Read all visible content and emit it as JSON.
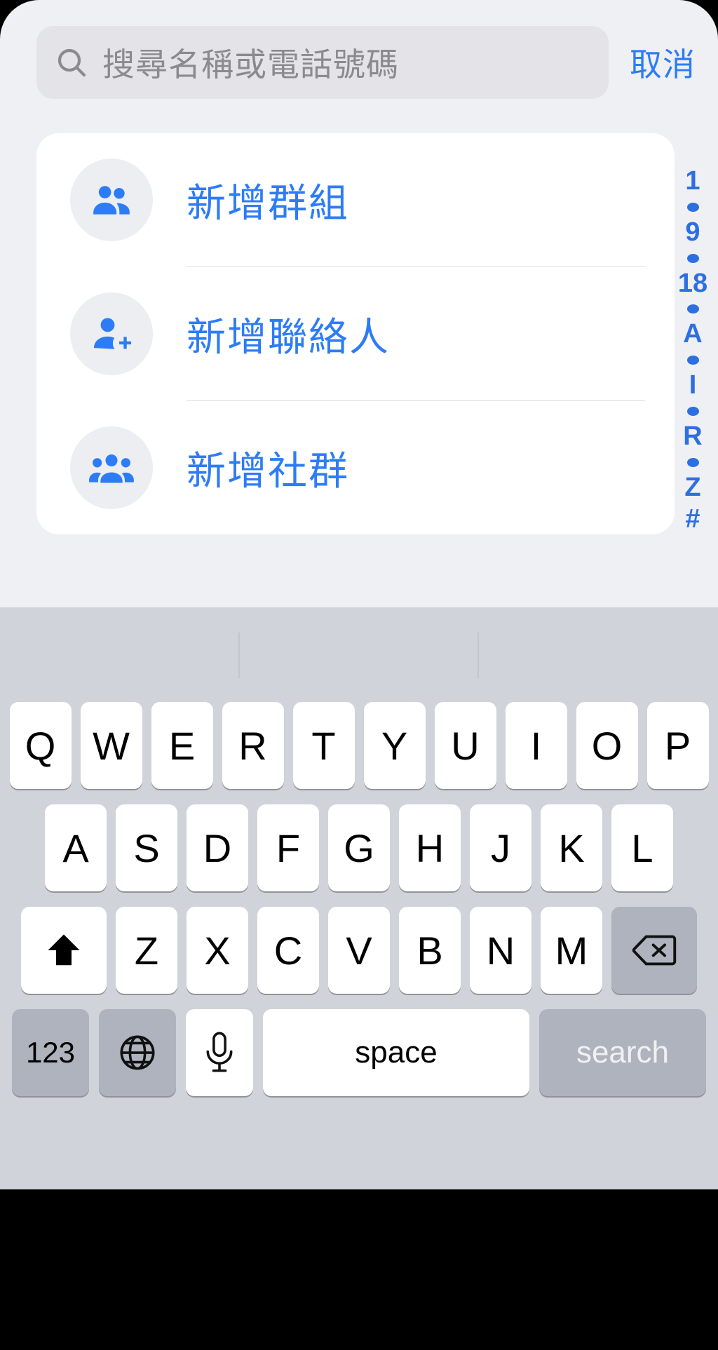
{
  "app": {
    "background_color": "#eff0f4",
    "accent_color": "#2d7cf6"
  },
  "search": {
    "placeholder": "搜尋名稱或電話號碼",
    "value": "",
    "icon": "search-icon",
    "cancel_label": "取消"
  },
  "actions": [
    {
      "label": "新增群組",
      "icon": "group-two-people-icon"
    },
    {
      "label": "新增聯絡人",
      "icon": "person-add-icon"
    },
    {
      "label": "新增社群",
      "icon": "community-three-people-icon"
    }
  ],
  "index_strip": {
    "entries": [
      "1",
      "•",
      "9",
      "•",
      "18",
      "•",
      "A",
      "•",
      "I",
      "•",
      "R",
      "•",
      "Z",
      "#"
    ]
  },
  "keyboard": {
    "prediction_bar": {
      "suggestions": [
        "",
        "",
        ""
      ]
    },
    "row1": [
      "Q",
      "W",
      "E",
      "R",
      "T",
      "Y",
      "U",
      "I",
      "O",
      "P"
    ],
    "row2": [
      "A",
      "S",
      "D",
      "F",
      "G",
      "H",
      "J",
      "K",
      "L"
    ],
    "row3_letters": [
      "Z",
      "X",
      "C",
      "V",
      "B",
      "N",
      "M"
    ],
    "shift_icon": "shift-up-arrow-icon",
    "backspace_icon": "backspace-delete-icon",
    "numbers_label": "123",
    "globe_icon": "globe-language-icon",
    "mic_icon": "microphone-icon",
    "space_label": "space",
    "return_label": "search"
  }
}
